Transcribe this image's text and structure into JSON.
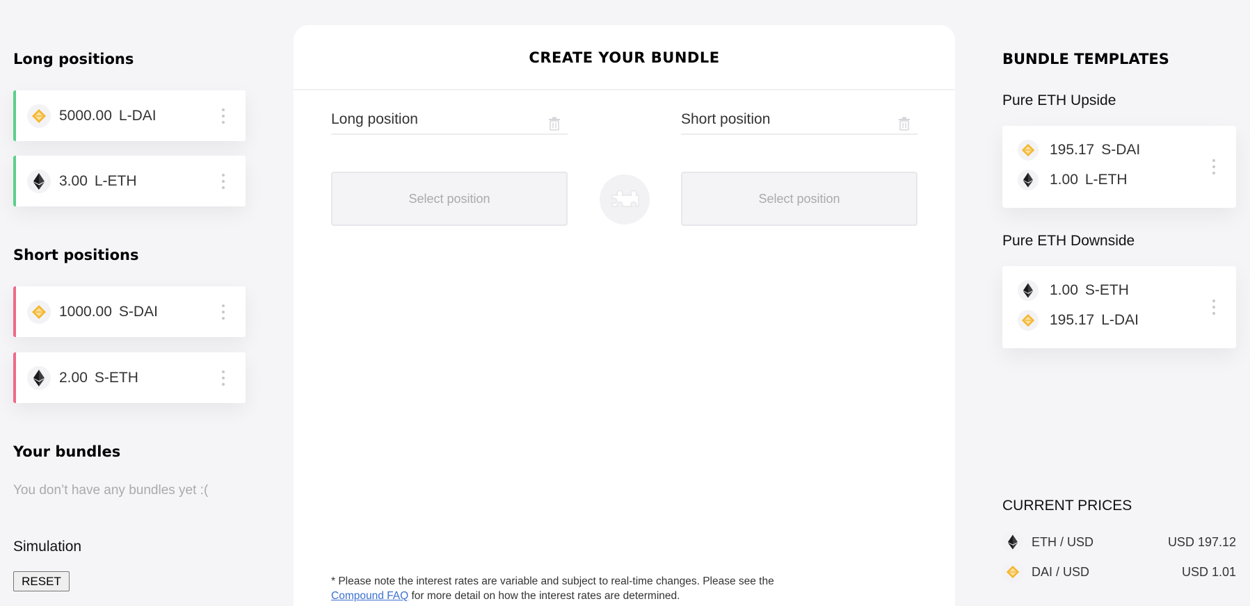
{
  "left": {
    "long_title": "Long positions",
    "long_positions": [
      {
        "amount": "5000.00",
        "symbol": "L-DAI",
        "icon": "dai-icon"
      },
      {
        "amount": "3.00",
        "symbol": "L-ETH",
        "icon": "eth-icon"
      }
    ],
    "short_title": "Short positions",
    "short_positions": [
      {
        "amount": "1000.00",
        "symbol": "S-DAI",
        "icon": "dai-icon"
      },
      {
        "amount": "2.00",
        "symbol": "S-ETH",
        "icon": "eth-icon"
      }
    ],
    "bundles_title": "Your bundles",
    "bundles_empty": "You don’t have any bundles yet :(",
    "simulation_title": "Simulation",
    "reset_label": "RESET"
  },
  "center": {
    "title": "CREATE YOUR BUNDLE",
    "long_label": "Long position",
    "short_label": "Short position",
    "select_placeholder": "Select position",
    "footnote_before": "* Please note the interest rates are variable and subject to real-time changes. Please see the",
    "footnote_link": "Compound FAQ",
    "footnote_after": " for more detail on how the interest rates are determined."
  },
  "right": {
    "title": "BUNDLE TEMPLATES",
    "templates": [
      {
        "name": "Pure ETH Upside",
        "rows": [
          {
            "amount": "195.17",
            "symbol": "S-DAI",
            "icon": "dai-icon"
          },
          {
            "amount": "1.00",
            "symbol": "L-ETH",
            "icon": "eth-icon"
          }
        ]
      },
      {
        "name": "Pure ETH Downside",
        "rows": [
          {
            "amount": "1.00",
            "symbol": "S-ETH",
            "icon": "eth-icon"
          },
          {
            "amount": "195.17",
            "symbol": "L-DAI",
            "icon": "dai-icon"
          }
        ]
      }
    ],
    "prices_title": "CURRENT PRICES",
    "prices": [
      {
        "pair": "ETH / USD",
        "value": "USD 197.12",
        "icon": "eth-icon"
      },
      {
        "pair": "DAI / USD",
        "value": "USD 1.01",
        "icon": "dai-icon"
      }
    ]
  },
  "colors": {
    "long_accent": "#5cd08a",
    "short_accent": "#ee6a8a",
    "dai_gold": "#f4b731",
    "link": "#3b6fd1"
  }
}
